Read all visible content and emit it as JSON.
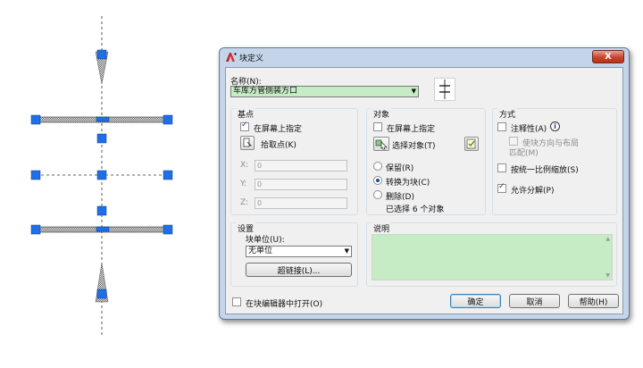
{
  "dialog": {
    "title": "块定义",
    "close_label": "X"
  },
  "name": {
    "label": "名称(N):",
    "value": "车库方管侧装方口"
  },
  "base_point": {
    "title": "基点",
    "specify_on_screen": "在屏幕上指定",
    "specify_checked": true,
    "pick_point": "拾取点(K)",
    "x_label": "X:",
    "x_value": "0",
    "y_label": "Y:",
    "y_value": "0",
    "z_label": "Z:",
    "z_value": "0"
  },
  "objects": {
    "title": "对象",
    "specify_on_screen": "在屏幕上指定",
    "specify_checked": false,
    "select_objects": "选择对象(T)",
    "retain": "保留(R)",
    "convert_to_block": "转换为块(C)",
    "delete": "删除(D)",
    "selected_count": "已选择 6 个对象",
    "selected_option": "convert_to_block"
  },
  "behavior": {
    "title": "方式",
    "annotative": "注释性(A)",
    "annotative_checked": false,
    "match_orientation": "使块方向与布局",
    "match_orientation_2": "匹配(M)",
    "scale_uniformly": "按统一比例缩放(S)",
    "scale_checked": false,
    "allow_exploding": "允许分解(P)",
    "explode_checked": true
  },
  "settings": {
    "title": "设置",
    "block_unit_label": "块单位(U):",
    "block_unit_value": "无单位",
    "hyperlink_button": "超链接(L)..."
  },
  "description": {
    "title": "说明",
    "value": ""
  },
  "footer": {
    "open_in_editor": "在块编辑器中打开(O)",
    "open_checked": false,
    "ok": "确定",
    "cancel": "取消",
    "help": "帮助(H)"
  },
  "colors": {
    "grip_blue": "#1f6fe8",
    "highlight_green": "#c6ecc6",
    "dialog_frame": "#c4d5ea"
  }
}
